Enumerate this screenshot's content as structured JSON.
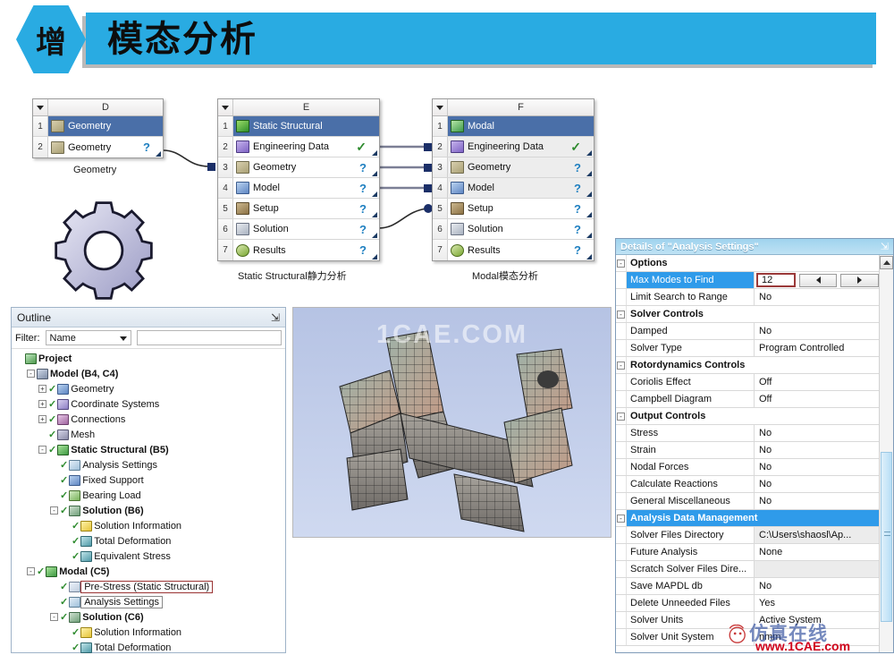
{
  "title": {
    "badge": "增",
    "heading": "模态分析"
  },
  "workflow": {
    "systems": [
      {
        "letter": "D",
        "caption": "Geometry",
        "rows": [
          {
            "n": "1",
            "label": "Geometry",
            "icon": "geometry-icon",
            "status": "",
            "header": true
          },
          {
            "n": "2",
            "label": "Geometry",
            "icon": "geometry-icon",
            "status": "?"
          }
        ]
      },
      {
        "letter": "E",
        "caption": "Static Structural静力分析",
        "rows": [
          {
            "n": "1",
            "label": "Static Structural",
            "icon": "static-structural-icon",
            "status": "",
            "header": true
          },
          {
            "n": "2",
            "label": "Engineering Data",
            "icon": "engineering-data-icon",
            "status": "✓"
          },
          {
            "n": "3",
            "label": "Geometry",
            "icon": "geometry-icon",
            "status": "?"
          },
          {
            "n": "4",
            "label": "Model",
            "icon": "model-icon",
            "status": "?"
          },
          {
            "n": "5",
            "label": "Setup",
            "icon": "setup-icon",
            "status": "?"
          },
          {
            "n": "6",
            "label": "Solution",
            "icon": "solution-icon",
            "status": "?"
          },
          {
            "n": "7",
            "label": "Results",
            "icon": "results-icon",
            "status": "?"
          }
        ]
      },
      {
        "letter": "F",
        "caption": "Modal模态分析",
        "rows": [
          {
            "n": "1",
            "label": "Modal",
            "icon": "modal-icon",
            "status": "",
            "header": true
          },
          {
            "n": "2",
            "label": "Engineering Data",
            "icon": "engineering-data-icon",
            "status": "✓"
          },
          {
            "n": "3",
            "label": "Geometry",
            "icon": "geometry-icon",
            "status": "?"
          },
          {
            "n": "4",
            "label": "Model",
            "icon": "model-icon",
            "status": "?"
          },
          {
            "n": "5",
            "label": "Setup",
            "icon": "setup-icon",
            "status": "?"
          },
          {
            "n": "6",
            "label": "Solution",
            "icon": "solution-icon",
            "status": "?"
          },
          {
            "n": "7",
            "label": "Results",
            "icon": "results-icon",
            "status": "?"
          }
        ]
      }
    ]
  },
  "outline": {
    "title": "Outline",
    "pin": "⇲",
    "filter_label": "Filter:",
    "filter_value": "Name",
    "filter_text": "",
    "tree": [
      {
        "depth": 0,
        "label": "Project",
        "icon": "project-icon",
        "bold": true,
        "expander": "",
        "check": false
      },
      {
        "depth": 1,
        "label": "Model (B4, C4)",
        "icon": "model-icon",
        "bold": true,
        "expander": "-",
        "check": false
      },
      {
        "depth": 2,
        "label": "Geometry",
        "icon": "geometry-icon",
        "bold": false,
        "expander": "+",
        "check": true
      },
      {
        "depth": 2,
        "label": "Coordinate Systems",
        "icon": "coordinate-systems-icon",
        "bold": false,
        "expander": "+",
        "check": true
      },
      {
        "depth": 2,
        "label": "Connections",
        "icon": "connections-icon",
        "bold": false,
        "expander": "+",
        "check": true
      },
      {
        "depth": 2,
        "label": "Mesh",
        "icon": "mesh-icon",
        "bold": false,
        "expander": "",
        "check": true
      },
      {
        "depth": 2,
        "label": "Static Structural (B5)",
        "icon": "environment-icon",
        "bold": true,
        "expander": "-",
        "check": true
      },
      {
        "depth": 3,
        "label": "Analysis Settings",
        "icon": "analysis-settings-icon",
        "bold": false,
        "expander": "",
        "check": true
      },
      {
        "depth": 3,
        "label": "Fixed Support",
        "icon": "fixed-support-icon",
        "bold": false,
        "expander": "",
        "check": true
      },
      {
        "depth": 3,
        "label": "Bearing Load",
        "icon": "bearing-load-icon",
        "bold": false,
        "expander": "",
        "check": true
      },
      {
        "depth": 3,
        "label": "Solution (B6)",
        "icon": "solution-icon",
        "bold": true,
        "expander": "-",
        "check": true
      },
      {
        "depth": 4,
        "label": "Solution Information",
        "icon": "solution-information-icon",
        "bold": false,
        "expander": "",
        "check": true
      },
      {
        "depth": 4,
        "label": "Total Deformation",
        "icon": "total-deformation-icon",
        "bold": false,
        "expander": "",
        "check": true
      },
      {
        "depth": 4,
        "label": "Equivalent Stress",
        "icon": "equivalent-stress-icon",
        "bold": false,
        "expander": "",
        "check": true
      },
      {
        "depth": 1,
        "label": "Modal (C5)",
        "icon": "modal-icon",
        "bold": true,
        "expander": "-",
        "check": true
      },
      {
        "depth": 3,
        "label": "Pre-Stress (Static Structural)",
        "icon": "pre-stress-icon",
        "bold": false,
        "expander": "",
        "check": true,
        "box": "red"
      },
      {
        "depth": 3,
        "label": "Analysis Settings",
        "icon": "analysis-settings-icon",
        "bold": false,
        "expander": "",
        "check": true,
        "box": "grey"
      },
      {
        "depth": 3,
        "label": "Solution (C6)",
        "icon": "solution-icon",
        "bold": true,
        "expander": "-",
        "check": true
      },
      {
        "depth": 4,
        "label": "Solution Information",
        "icon": "solution-information-icon",
        "bold": false,
        "expander": "",
        "check": true
      },
      {
        "depth": 4,
        "label": "Total Deformation",
        "icon": "total-deformation-icon",
        "bold": false,
        "expander": "",
        "check": true
      }
    ]
  },
  "viewport": {
    "watermark": "1CAE.COM"
  },
  "details": {
    "title": "Details of \"Analysis Settings\"",
    "pin": "⇲",
    "rows": [
      {
        "type": "group",
        "key": "Options",
        "value": "",
        "expander": "-"
      },
      {
        "type": "spin",
        "key": "Max Modes to Find",
        "value": "12",
        "selected": true,
        "prev": "◄",
        "next": "►"
      },
      {
        "type": "item",
        "key": "Limit Search to Range",
        "value": "No"
      },
      {
        "type": "group",
        "key": "Solver Controls",
        "value": "",
        "expander": "-"
      },
      {
        "type": "item",
        "key": "Damped",
        "value": "No"
      },
      {
        "type": "item",
        "key": "Solver Type",
        "value": "Program Controlled"
      },
      {
        "type": "group",
        "key": "Rotordynamics Controls",
        "value": "",
        "expander": "-"
      },
      {
        "type": "item",
        "key": "Coriolis Effect",
        "value": "Off"
      },
      {
        "type": "item",
        "key": "Campbell Diagram",
        "value": "Off"
      },
      {
        "type": "group",
        "key": "Output Controls",
        "value": "",
        "expander": "-"
      },
      {
        "type": "item",
        "key": "Stress",
        "value": "No"
      },
      {
        "type": "item",
        "key": "Strain",
        "value": "No"
      },
      {
        "type": "item",
        "key": "Nodal Forces",
        "value": "No"
      },
      {
        "type": "item",
        "key": "Calculate Reactions",
        "value": "No"
      },
      {
        "type": "item",
        "key": "General Miscellaneous",
        "value": "No"
      },
      {
        "type": "group-selected",
        "key": "Analysis Data Management",
        "value": "",
        "expander": "-"
      },
      {
        "type": "item",
        "key": "Solver Files Directory",
        "value": "C:\\Users\\shaosl\\Ap...",
        "readonly": true
      },
      {
        "type": "item",
        "key": "Future Analysis",
        "value": "None"
      },
      {
        "type": "item",
        "key": "Scratch Solver Files Dire...",
        "value": "",
        "readonly": true
      },
      {
        "type": "item",
        "key": "Save MAPDL db",
        "value": "No"
      },
      {
        "type": "item",
        "key": "Delete Unneeded Files",
        "value": "Yes"
      },
      {
        "type": "item",
        "key": "Solver Units",
        "value": "Active System"
      },
      {
        "type": "item",
        "key": "Solver Unit System",
        "value": "nmm"
      }
    ]
  },
  "watermarks": {
    "cn": "仿真在线",
    "url": "www.1CAE.com"
  }
}
